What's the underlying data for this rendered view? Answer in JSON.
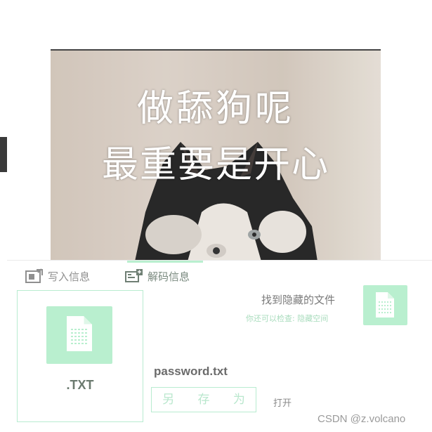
{
  "preview": {
    "caption_line1": "做舔狗呢",
    "caption_line2": "最重要是开心"
  },
  "tabs": [
    {
      "label": "写入信息",
      "icon": "write-icon",
      "active": false
    },
    {
      "label": "解码信息",
      "icon": "decode-icon",
      "active": true
    }
  ],
  "file_card": {
    "icon": "file-icon",
    "extension": ".TXT"
  },
  "file": {
    "name": "password.txt",
    "save_as_label": "另 存 为",
    "open_label": "打开"
  },
  "found": {
    "title": "找到隐藏的文件",
    "subtitle": "你还可以检查: 隐藏空间",
    "icon": "file-icon"
  },
  "watermark": "CSDN @z.volcano",
  "colors": {
    "accent_green": "#b9efcf",
    "border_green": "#b8ecd0",
    "text_gray": "#8f8f8f"
  }
}
